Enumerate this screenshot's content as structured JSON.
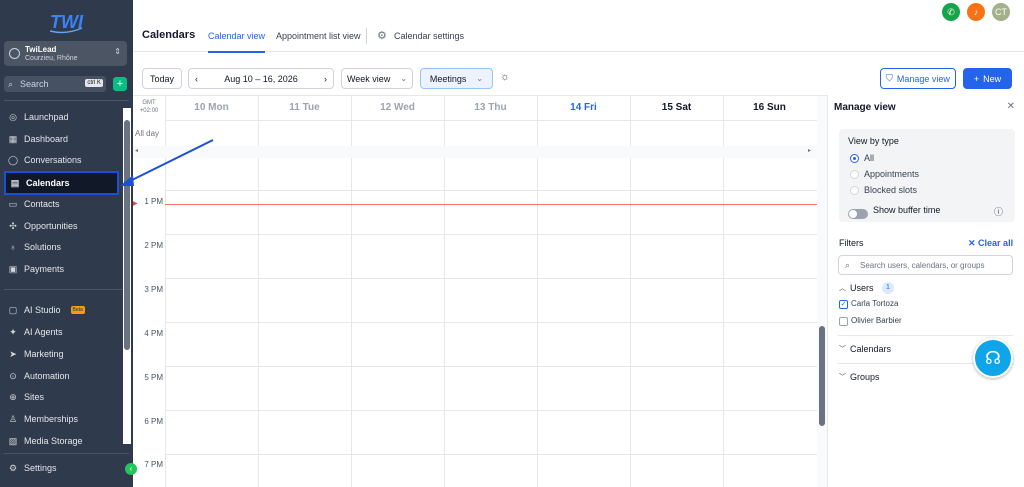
{
  "sidebar": {
    "account": {
      "name": "TwiLead",
      "location": "Courzieu, Rhône"
    },
    "search": {
      "placeholder": "Search",
      "shortcut": "ctrl K"
    },
    "items": [
      {
        "label": "Launchpad",
        "icon": "launchpad-icon"
      },
      {
        "label": "Dashboard",
        "icon": "dashboard-icon"
      },
      {
        "label": "Conversations",
        "icon": "chat-icon"
      },
      {
        "label": "Calendars",
        "icon": "calendar-icon",
        "active": true
      },
      {
        "label": "Contacts",
        "icon": "contacts-icon"
      },
      {
        "label": "Opportunities",
        "icon": "opportunities-icon"
      },
      {
        "label": "Solutions",
        "icon": "lightbulb-icon"
      },
      {
        "label": "Payments",
        "icon": "payments-icon"
      },
      {
        "label": "AI Studio",
        "icon": "ai-studio-icon",
        "badge": "Beta"
      },
      {
        "label": "AI Agents",
        "icon": "sparkle-icon"
      },
      {
        "label": "Marketing",
        "icon": "send-icon"
      },
      {
        "label": "Automation",
        "icon": "automation-icon"
      },
      {
        "label": "Sites",
        "icon": "globe-icon"
      },
      {
        "label": "Memberships",
        "icon": "memberships-icon"
      },
      {
        "label": "Media Storage",
        "icon": "image-icon"
      },
      {
        "label": "Settings",
        "icon": "gear-icon"
      }
    ]
  },
  "header": {
    "title": "Calendars",
    "tabs": [
      "Calendar view",
      "Appointment list view",
      "Calendar settings"
    ],
    "avatar_initials": "CT"
  },
  "toolbar": {
    "today": "Today",
    "date_range": "Aug 10 – 16, 2026",
    "view": "Week view",
    "filter": "Meetings",
    "manage_view": "Manage view",
    "new": "New"
  },
  "calendar": {
    "timezone": [
      "GMT",
      "+02:00"
    ],
    "days": [
      "10 Mon",
      "11 Tue",
      "12 Wed",
      "13 Thu",
      "14 Fri",
      "15 Sat",
      "16 Sun"
    ],
    "all_day": "All day",
    "hours": [
      "1 PM",
      "2 PM",
      "3 PM",
      "4 PM",
      "5 PM",
      "6 PM",
      "7 PM"
    ]
  },
  "panel": {
    "title": "Manage view",
    "view_by_type": "View by type",
    "types": [
      "All",
      "Appointments",
      "Blocked slots"
    ],
    "buffer": "Show buffer time",
    "filters": "Filters",
    "clear_all": "Clear all",
    "search_placeholder": "Search users, calendars, or groups",
    "users_label": "Users",
    "users_count": "1",
    "users": [
      {
        "name": "Carla Tortoza",
        "checked": true
      },
      {
        "name": "Olivier Barbier",
        "checked": false
      }
    ],
    "calendars": "Calendars",
    "groups": "Groups"
  },
  "colors": {
    "accent": "#2563eb",
    "sidebar": "#2f3a4c",
    "now_line": "#f87171"
  }
}
